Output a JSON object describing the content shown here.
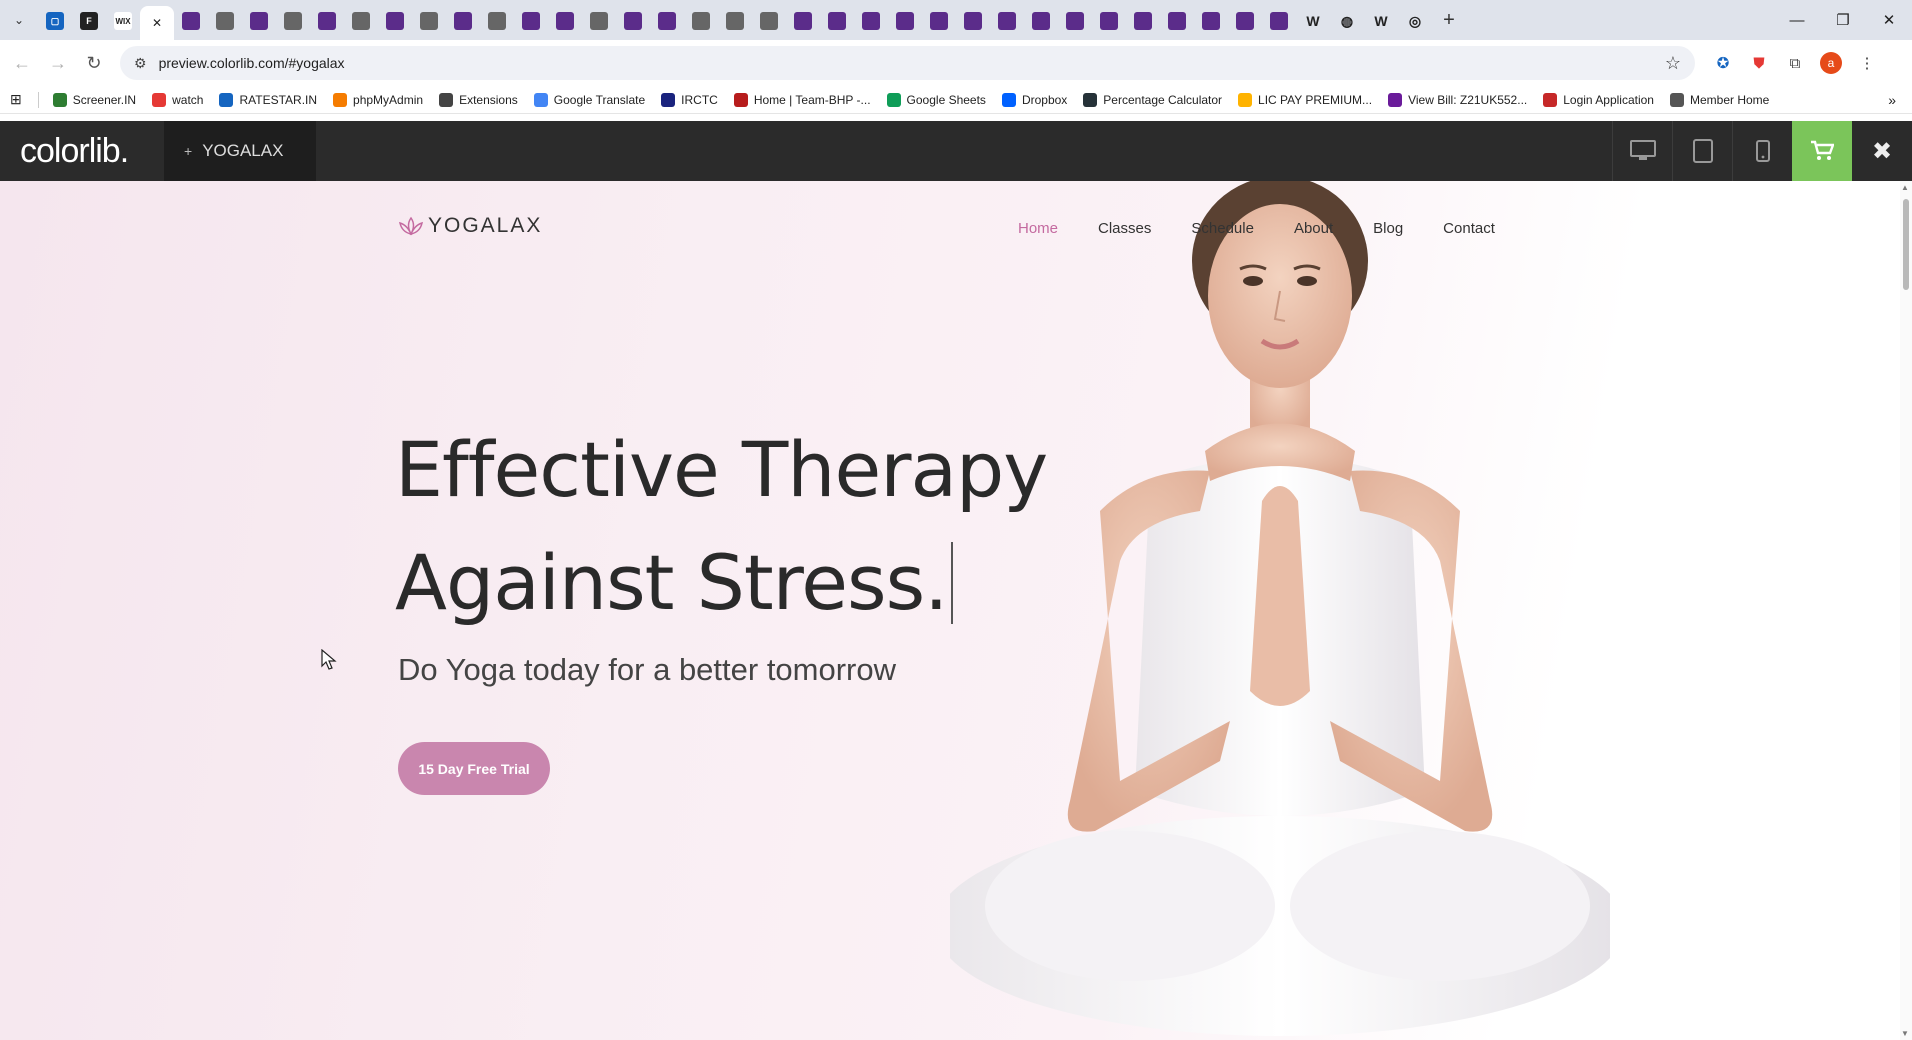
{
  "browser": {
    "active_tab_close": "✕",
    "new_tab": "+",
    "url": "preview.colorlib.com/#yogalax",
    "bookmarks": [
      {
        "label": "Screener.IN",
        "color": "#2e7d32"
      },
      {
        "label": "watch",
        "color": "#e53935"
      },
      {
        "label": "RATESTAR.IN",
        "color": "#1565c0"
      },
      {
        "label": "phpMyAdmin",
        "color": "#f57c00"
      },
      {
        "label": "Extensions",
        "color": "#444444"
      },
      {
        "label": "Google Translate",
        "color": "#4285f4"
      },
      {
        "label": "IRCTC",
        "color": "#1a237e"
      },
      {
        "label": "Home | Team-BHP -...",
        "color": "#b71c1c"
      },
      {
        "label": "Google Sheets",
        "color": "#0f9d58"
      },
      {
        "label": "Dropbox",
        "color": "#0061ff"
      },
      {
        "label": "Percentage Calculator",
        "color": "#263238"
      },
      {
        "label": "LIC PAY PREMIUM...",
        "color": "#ffb300"
      },
      {
        "label": "View Bill: Z21UK552...",
        "color": "#6a1b9a"
      },
      {
        "label": "Login Application",
        "color": "#c62828"
      },
      {
        "label": "Member Home",
        "color": "#555555"
      }
    ],
    "profile_initial": "a"
  },
  "colorlib_bar": {
    "logo": "colorlib.",
    "theme_label": "YOGALAX"
  },
  "site": {
    "logo": "YOGALAX",
    "nav": [
      "Home",
      "Classes",
      "Schedule",
      "About",
      "Blog",
      "Contact"
    ],
    "hero_line1": "Effective Therapy",
    "hero_line2": "Against Stress.",
    "subtitle": "Do Yoga today for a better tomorrow",
    "cta": "15 Day Free Trial"
  },
  "colors": {
    "accent": "#c986ae",
    "nav_active": "#c46aa0",
    "cart": "#7bc55a"
  }
}
